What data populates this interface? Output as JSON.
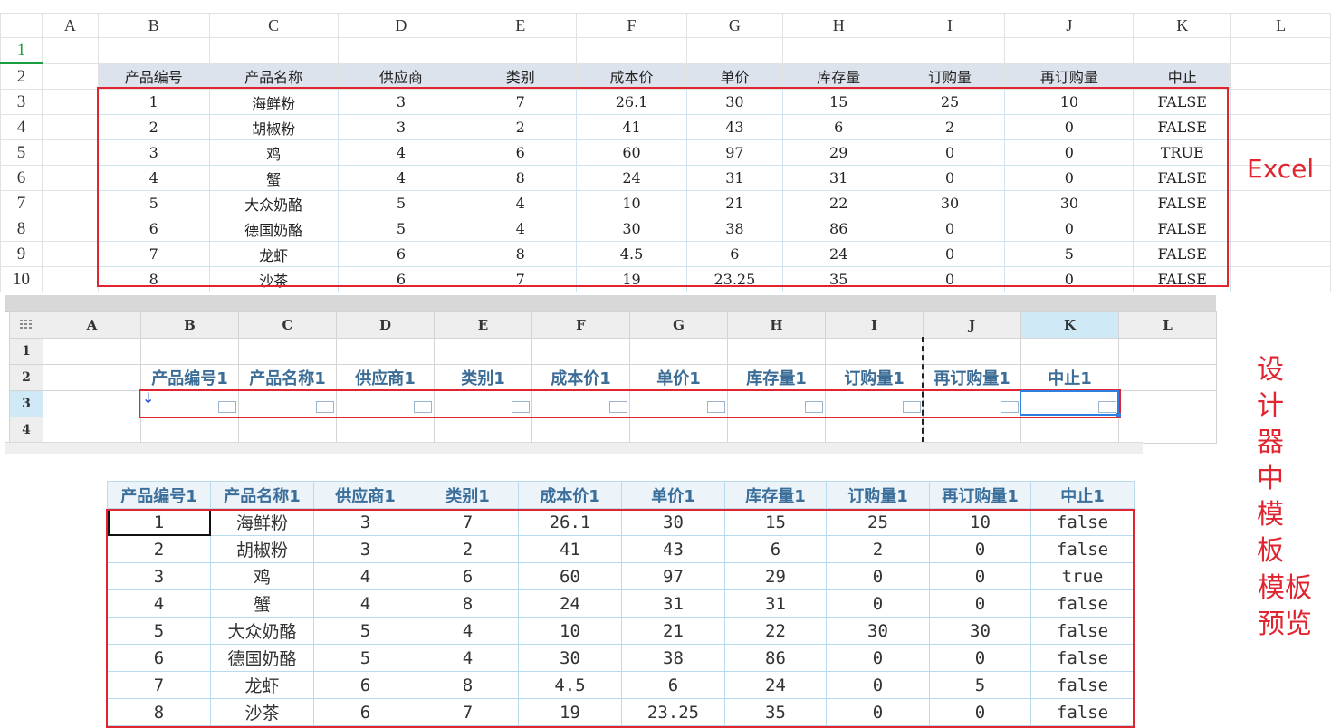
{
  "excel": {
    "label": "Excel",
    "columns": [
      "",
      "A",
      "B",
      "C",
      "D",
      "E",
      "F",
      "G",
      "H",
      "I",
      "J",
      "K",
      "L"
    ],
    "row_numbers": [
      "1",
      "2",
      "3",
      "4",
      "5",
      "6",
      "7",
      "8",
      "9",
      "10"
    ],
    "headers": [
      "产品编号",
      "产品名称",
      "供应商",
      "类别",
      "成本价",
      "单价",
      "库存量",
      "订购量",
      "再订购量",
      "中止"
    ],
    "rows": [
      [
        "1",
        "海鲜粉",
        "3",
        "7",
        "26.1",
        "30",
        "15",
        "25",
        "10",
        "FALSE"
      ],
      [
        "2",
        "胡椒粉",
        "3",
        "2",
        "41",
        "43",
        "6",
        "2",
        "0",
        "FALSE"
      ],
      [
        "3",
        "鸡",
        "4",
        "6",
        "60",
        "97",
        "29",
        "0",
        "0",
        "TRUE"
      ],
      [
        "4",
        "蟹",
        "4",
        "8",
        "24",
        "31",
        "31",
        "0",
        "0",
        "FALSE"
      ],
      [
        "5",
        "大众奶酪",
        "5",
        "4",
        "10",
        "21",
        "22",
        "30",
        "30",
        "FALSE"
      ],
      [
        "6",
        "德国奶酪",
        "5",
        "4",
        "30",
        "38",
        "86",
        "0",
        "0",
        "FALSE"
      ],
      [
        "7",
        "龙虾",
        "6",
        "8",
        "4.5",
        "6",
        "24",
        "0",
        "5",
        "FALSE"
      ],
      [
        "8",
        "沙茶",
        "6",
        "7",
        "19",
        "23.25",
        "35",
        "0",
        "0",
        "FALSE"
      ]
    ]
  },
  "designer": {
    "label_lines": [
      "设计",
      "器中",
      "模板"
    ],
    "grid_icon": "grid-icon",
    "columns": [
      "A",
      "B",
      "C",
      "D",
      "E",
      "F",
      "G",
      "H",
      "I",
      "J",
      "K",
      "L"
    ],
    "row_numbers": [
      "1",
      "2",
      "3",
      "4"
    ],
    "headers": [
      "产品编号1",
      "产品名称1",
      "供应商1",
      "类别1",
      "成本价1",
      "单价1",
      "库存量1",
      "订购量1",
      "再订购量1",
      "中止1"
    ],
    "selected_column": "K",
    "selected_row": "3"
  },
  "preview": {
    "label_lines": [
      "模板",
      "预览"
    ],
    "headers": [
      "产品编号1",
      "产品名称1",
      "供应商1",
      "类别1",
      "成本价1",
      "单价1",
      "库存量1",
      "订购量1",
      "再订购量1",
      "中止1"
    ],
    "rows": [
      [
        "1",
        "海鲜粉",
        "3",
        "7",
        "26.1",
        "30",
        "15",
        "25",
        "10",
        "false"
      ],
      [
        "2",
        "胡椒粉",
        "3",
        "2",
        "41",
        "43",
        "6",
        "2",
        "0",
        "false"
      ],
      [
        "3",
        "鸡",
        "4",
        "6",
        "60",
        "97",
        "29",
        "0",
        "0",
        "true"
      ],
      [
        "4",
        "蟹",
        "4",
        "8",
        "24",
        "31",
        "31",
        "0",
        "0",
        "false"
      ],
      [
        "5",
        "大众奶酪",
        "5",
        "4",
        "10",
        "21",
        "22",
        "30",
        "30",
        "false"
      ],
      [
        "6",
        "德国奶酪",
        "5",
        "4",
        "30",
        "38",
        "86",
        "0",
        "0",
        "false"
      ],
      [
        "7",
        "龙虾",
        "6",
        "8",
        "4.5",
        "6",
        "24",
        "0",
        "5",
        "false"
      ],
      [
        "8",
        "沙茶",
        "6",
        "7",
        "19",
        "23.25",
        "35",
        "0",
        "0",
        "false"
      ]
    ]
  },
  "colors": {
    "annotation_red": "#e02530",
    "header_blue_text": "#3b6f9b",
    "selection_blue": "#2f7fe0",
    "active_row_green": "#1a9e3f"
  }
}
